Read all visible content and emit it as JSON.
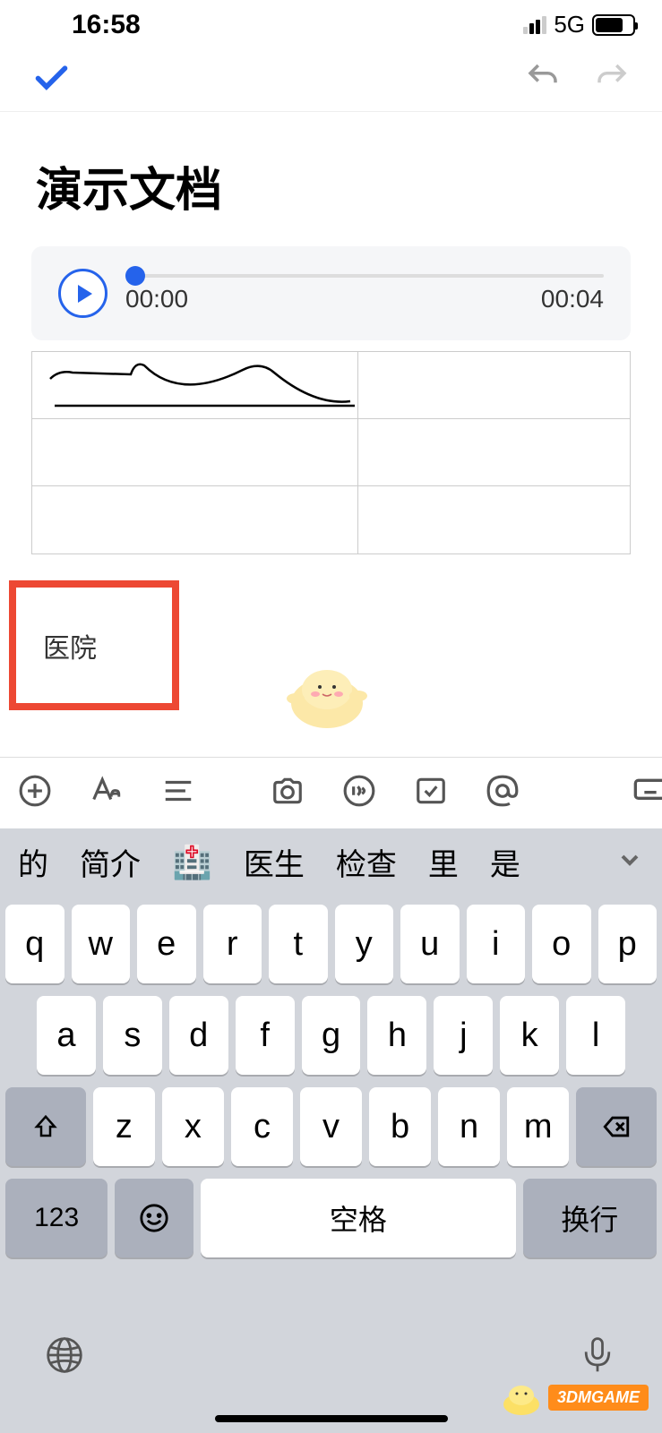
{
  "status": {
    "time": "16:58",
    "network": "5G"
  },
  "doc": {
    "title": "演示文档"
  },
  "audio": {
    "current": "00:00",
    "duration": "00:04"
  },
  "highlight": {
    "text": "医院"
  },
  "suggestions": [
    "的",
    "简介",
    "🏥",
    "医生",
    "检查",
    "里",
    "是"
  ],
  "keyboard": {
    "row1": [
      "q",
      "w",
      "e",
      "r",
      "t",
      "y",
      "u",
      "i",
      "o",
      "p"
    ],
    "row2": [
      "a",
      "s",
      "d",
      "f",
      "g",
      "h",
      "j",
      "k",
      "l"
    ],
    "row3": [
      "z",
      "x",
      "c",
      "v",
      "b",
      "n",
      "m"
    ],
    "numKey": "123",
    "space": "空格",
    "enter": "换行"
  },
  "watermark": "3DMGAME"
}
